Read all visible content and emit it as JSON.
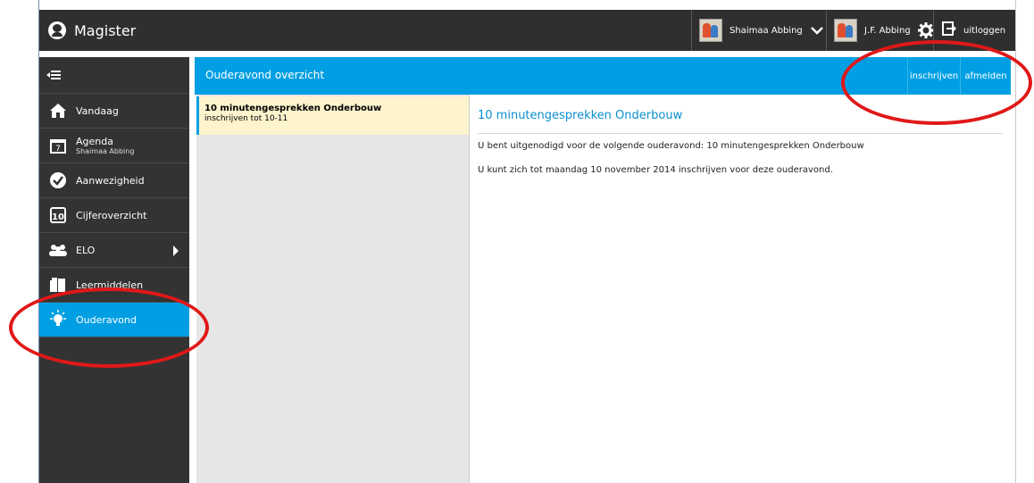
{
  "app": {
    "title": "Magister"
  },
  "topbar": {
    "user_name": "Shaimaa Abbing",
    "account_name": "J.F. Abbing",
    "logout_label": "uitloggen"
  },
  "sidebar": {
    "items": [
      {
        "label": "Vandaag",
        "icon": "home-icon"
      },
      {
        "label": "Agenda",
        "sub": "Shaimaa Abbing",
        "icon": "calendar-icon"
      },
      {
        "label": "Aanwezigheid",
        "icon": "checkmark-icon"
      },
      {
        "label": "Cijferoverzicht",
        "icon": "grade-10-icon"
      },
      {
        "label": "ELO",
        "icon": "group-icon"
      },
      {
        "label": "Leermiddelen",
        "icon": "books-icon"
      },
      {
        "label": "Ouderavond",
        "icon": "lightbulb-icon",
        "active": true
      }
    ]
  },
  "header": {
    "title": "Ouderavond overzicht",
    "buttons": [
      "inschrijven",
      "afmelden"
    ]
  },
  "list": {
    "items": [
      {
        "title": "10 minutengesprekken Onderbouw",
        "subtitle": "inschrijven tot 10-11"
      }
    ]
  },
  "detail": {
    "title": "10 minutengesprekken Onderbouw",
    "line1": "U bent uitgenodigd voor de volgende ouderavond: 10 minutengesprekken Onderbouw",
    "line2": "U kunt zich tot maandag 10 november 2014 inschrijven voor deze ouderavond."
  },
  "colors": {
    "accent": "#009fe3",
    "sidebar": "#333333",
    "topbar": "#2f2f2f",
    "selected_item": "#fdf3cc",
    "annotation": "#e01818"
  }
}
